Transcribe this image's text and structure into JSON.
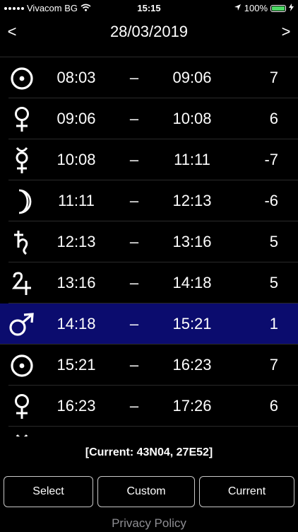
{
  "status_bar": {
    "carrier": "Vivacom BG",
    "time": "15:15",
    "battery": "100%",
    "battery_level": 1.0,
    "battery_color": "#4cd964"
  },
  "header": {
    "prev_label": "<",
    "date": "28/03/2019",
    "next_label": ">"
  },
  "hours": [
    {
      "planet": "sun-icon",
      "start": "08:03",
      "dash": "–",
      "end": "09:06",
      "value": "7"
    },
    {
      "planet": "venus-icon",
      "start": "09:06",
      "dash": "–",
      "end": "10:08",
      "value": "6"
    },
    {
      "planet": "mercury-icon",
      "start": "10:08",
      "dash": "–",
      "end": "11:11",
      "value": "-7"
    },
    {
      "planet": "moon-icon",
      "start": "11:11",
      "dash": "–",
      "end": "12:13",
      "value": "-6"
    },
    {
      "planet": "saturn-icon",
      "start": "12:13",
      "dash": "–",
      "end": "13:16",
      "value": "5"
    },
    {
      "planet": "jupiter-icon",
      "start": "13:16",
      "dash": "–",
      "end": "14:18",
      "value": "5"
    },
    {
      "planet": "mars-icon",
      "start": "14:18",
      "dash": "–",
      "end": "15:21",
      "value": "1",
      "selected": true
    },
    {
      "planet": "sun-icon",
      "start": "15:21",
      "dash": "–",
      "end": "16:23",
      "value": "7"
    },
    {
      "planet": "venus-icon",
      "start": "16:23",
      "dash": "–",
      "end": "17:26",
      "value": "6"
    },
    {
      "planet": "mercury-icon",
      "start": "",
      "dash": "",
      "end": "",
      "value": ""
    }
  ],
  "highlight_color": "#0b0c6e",
  "location": {
    "text": "[Current: 43N04, 27E52]"
  },
  "buttons": {
    "select": "Select",
    "custom": "Custom",
    "current": "Current"
  },
  "privacy_link": "Privacy Policy"
}
